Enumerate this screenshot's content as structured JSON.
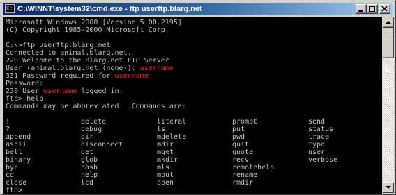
{
  "window": {
    "title": "C:\\WINNT\\system32\\cmd.exe - ftp userftp.blarg.net",
    "icon_name": "cmd-icon",
    "icon_text": "C:\\"
  },
  "colors": {
    "titlebar_start": "#0a246a",
    "titlebar_end": "#a6caf0",
    "console_bg": "#000000",
    "console_text": "#c0c0c0",
    "highlight": "#ff2020"
  },
  "console": {
    "lines": [
      {
        "parts": [
          {
            "text": "Microsoft Windows 2000 [Version 5.00.2195]"
          }
        ]
      },
      {
        "parts": [
          {
            "text": "(C) Copyright 1985-2000 Microsoft Corp."
          }
        ]
      },
      {
        "parts": [
          {
            "text": ""
          }
        ]
      },
      {
        "parts": [
          {
            "text": "C:\\>ftp userftp.blarg.net"
          }
        ]
      },
      {
        "parts": [
          {
            "text": "Connected to animal.blarg.net."
          }
        ]
      },
      {
        "parts": [
          {
            "text": "220 Welcome to the Blarg.net FTP Server"
          }
        ]
      },
      {
        "parts": [
          {
            "text": "User (animal.blarg.net:(none)): "
          },
          {
            "text": "username",
            "red": true
          }
        ]
      },
      {
        "parts": [
          {
            "text": "331 Password required for "
          },
          {
            "text": "username",
            "red": true
          }
        ]
      },
      {
        "parts": [
          {
            "text": "Password:"
          }
        ]
      },
      {
        "parts": [
          {
            "text": "230 User "
          },
          {
            "text": "username",
            "red": true
          },
          {
            "text": " logged in."
          }
        ]
      },
      {
        "parts": [
          {
            "text": "ftp> help"
          }
        ]
      },
      {
        "parts": [
          {
            "text": "Commands may be abbreviated.  Commands are:"
          }
        ]
      },
      {
        "parts": [
          {
            "text": ""
          }
        ]
      }
    ],
    "commands": [
      [
        "!",
        "delete",
        "literal",
        "prompt",
        "send"
      ],
      [
        "?",
        "debug",
        "ls",
        "put",
        "status"
      ],
      [
        "append",
        "dir",
        "mdelete",
        "pwd",
        "trace"
      ],
      [
        "ascii",
        "disconnect",
        "mdir",
        "quit",
        "type"
      ],
      [
        "bell",
        "get",
        "mget",
        "quote",
        "user"
      ],
      [
        "binary",
        "glob",
        "mkdir",
        "recv",
        "verbose"
      ],
      [
        "bye",
        "hash",
        "mls",
        "remotehelp",
        ""
      ],
      [
        "cd",
        "help",
        "mput",
        "rename",
        ""
      ],
      [
        "close",
        "lcd",
        "open",
        "rmdir",
        ""
      ]
    ],
    "prompt": "ftp>"
  }
}
